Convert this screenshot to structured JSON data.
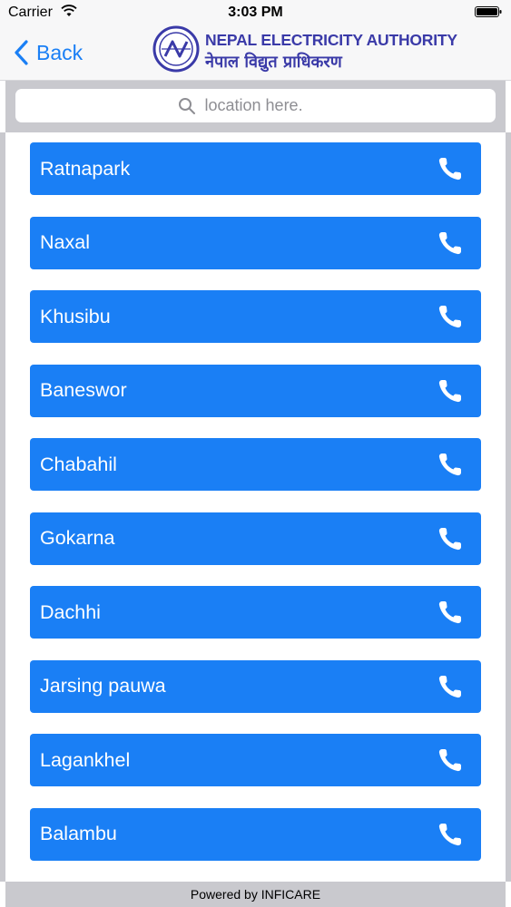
{
  "status_bar": {
    "carrier": "Carrier",
    "time": "3:03 PM"
  },
  "nav": {
    "back_label": "Back",
    "logo_en": "NEPAL ELECTRICITY AUTHORITY",
    "logo_ne": "नेपाल विद्युत प्राधिकरण"
  },
  "search": {
    "placeholder": "location here."
  },
  "locations": [
    {
      "label": "Ratnapark"
    },
    {
      "label": "Naxal"
    },
    {
      "label": "Khusibu"
    },
    {
      "label": "Baneswor"
    },
    {
      "label": "Chabahil"
    },
    {
      "label": "Gokarna"
    },
    {
      "label": "Dachhi"
    },
    {
      "label": "Jarsing pauwa"
    },
    {
      "label": "Lagankhel"
    },
    {
      "label": "Balambu"
    }
  ],
  "footer": {
    "text": "Powered by INFICARE"
  },
  "colors": {
    "accent": "#1a7ff5",
    "logo": "#3a3aa8",
    "frame": "#c9c9ce"
  }
}
